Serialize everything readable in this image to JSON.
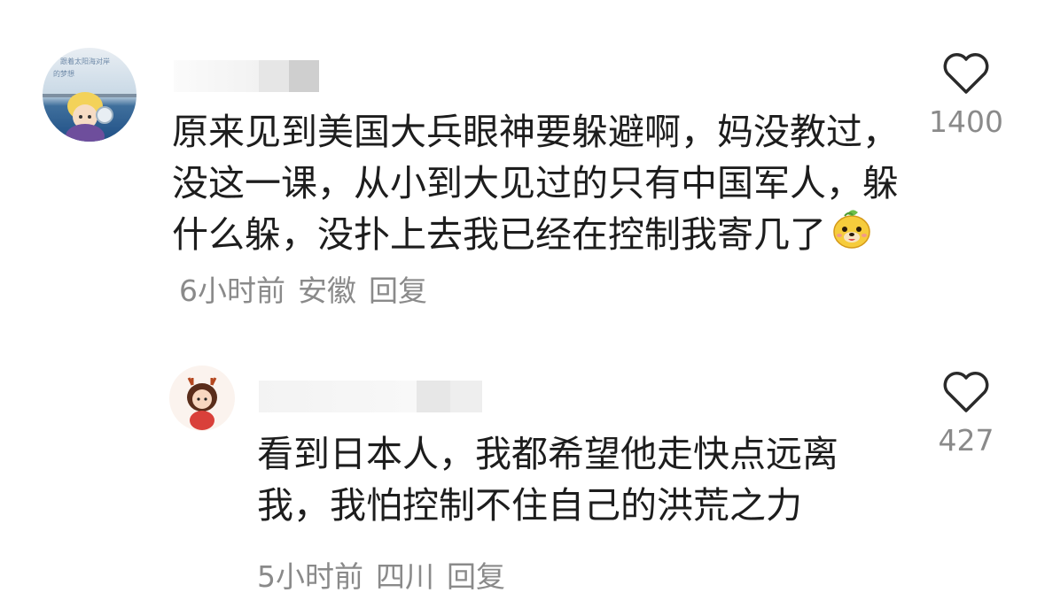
{
  "comments": [
    {
      "text": "原来见到美国大兵眼神要躲避啊，妈没教过，没这一课，从小到大见过的只有中国军人，躲什么躲，没扑上去我已经在控制我寄几了",
      "emoji_icon": "smiling-mango-emoji",
      "time": "6小时前",
      "location": "安徽",
      "reply_label": "回复",
      "likes": "1400",
      "avatar_text": "跟着太阳海对岸的梦想"
    },
    {
      "text": "看到日本人，我都希望他走快点远离我，我怕控制不住自己的洪荒之力",
      "time": "5小时前",
      "location": "四川",
      "reply_label": "回复",
      "likes": "427"
    }
  ],
  "icons": {
    "like": "heart-outline-icon"
  },
  "colors": {
    "text": "#1d1d1d",
    "meta": "#8a8a8a",
    "background": "#ffffff"
  }
}
